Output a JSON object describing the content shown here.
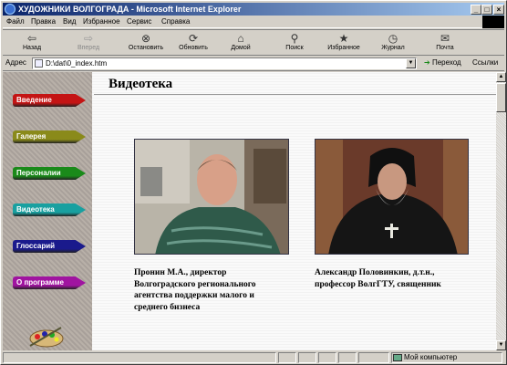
{
  "window": {
    "title": "ХУДОЖНИКИ ВОЛГОГРАДА - Microsoft Internet Explorer",
    "controls": [
      "_",
      "□",
      "×"
    ]
  },
  "menu": [
    "Файл",
    "Правка",
    "Вид",
    "Избранное",
    "Сервис",
    "Справка"
  ],
  "toolbar": {
    "back": "Назад",
    "forward": "Вперед",
    "stop": "Остановить",
    "refresh": "Обновить",
    "home": "Домой",
    "search": "Поиск",
    "favorites": "Избранное",
    "history": "Журнал",
    "mail": "Почта"
  },
  "address": {
    "label": "Адрес",
    "value": "D:\\dat\\0_index.htm",
    "go": "Переход",
    "links": "Ссылки"
  },
  "sidebar": {
    "items": [
      {
        "label": "Введение",
        "color": "#c41414"
      },
      {
        "label": "Галерея",
        "color": "#8a8a1a"
      },
      {
        "label": "Персоналии",
        "color": "#1a8a1a"
      },
      {
        "label": "Видеотека",
        "color": "#18a0a0"
      },
      {
        "label": "Глоссарий",
        "color": "#1a1a8c"
      },
      {
        "label": "О программе",
        "color": "#a014a0"
      }
    ]
  },
  "page": {
    "title": "Видеотека"
  },
  "videos": [
    {
      "caption": "Пронин М.А., директор Волгоградского регионального агентства поддержки малого и среднего бизнеса"
    },
    {
      "caption": "Александр Половинкин, д.т.н., профессор ВолгГТУ, священник"
    }
  ],
  "status": {
    "zone": "Мой компьютер"
  }
}
